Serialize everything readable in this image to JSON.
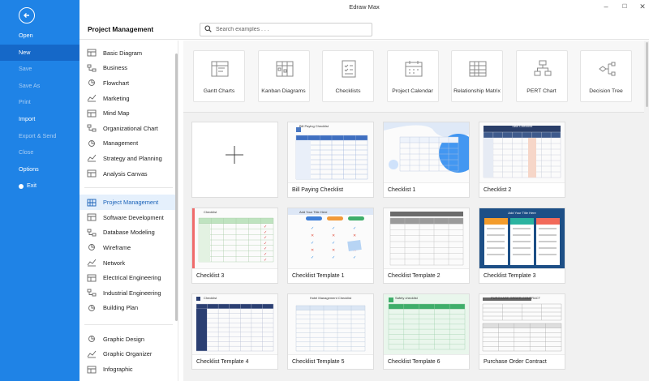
{
  "window": {
    "title": "Edraw Max",
    "controls": [
      "–",
      "☐",
      "✕"
    ]
  },
  "sidebar": {
    "items": [
      {
        "label": "Open",
        "state": "normal"
      },
      {
        "label": "New",
        "state": "active"
      },
      {
        "label": "Save",
        "state": "dim"
      },
      {
        "label": "Save As",
        "state": "dim"
      },
      {
        "label": "Print",
        "state": "dim"
      },
      {
        "label": "Import",
        "state": "normal"
      },
      {
        "label": "Export & Send",
        "state": "dim"
      },
      {
        "label": "Close",
        "state": "dim"
      },
      {
        "label": "Options",
        "state": "normal"
      },
      {
        "label": "Exit",
        "state": "normal"
      }
    ]
  },
  "header": {
    "section_title": "Project Management",
    "search_placeholder": "Search examples . . ."
  },
  "categories": {
    "group1": [
      {
        "label": "Basic Diagram",
        "icon": "basic-diagram-icon"
      },
      {
        "label": "Business",
        "icon": "business-icon"
      },
      {
        "label": "Flowchart",
        "icon": "flowchart-icon"
      },
      {
        "label": "Marketing",
        "icon": "marketing-icon"
      },
      {
        "label": "Mind Map",
        "icon": "mind-map-icon"
      },
      {
        "label": "Organizational Chart",
        "icon": "org-chart-icon"
      },
      {
        "label": "Management",
        "icon": "management-icon"
      },
      {
        "label": "Strategy and Planning",
        "icon": "strategy-icon"
      },
      {
        "label": "Analysis Canvas",
        "icon": "analysis-canvas-icon"
      }
    ],
    "group2": [
      {
        "label": "Project Management",
        "icon": "project-management-icon",
        "active": true
      },
      {
        "label": "Software Development",
        "icon": "software-icon"
      },
      {
        "label": "Database Modeling",
        "icon": "database-icon"
      },
      {
        "label": "Wireframe",
        "icon": "wireframe-icon"
      },
      {
        "label": "Network",
        "icon": "network-icon"
      },
      {
        "label": "Electrical Engineering",
        "icon": "electrical-icon"
      },
      {
        "label": "Industrial Engineering",
        "icon": "industrial-icon"
      },
      {
        "label": "Building Plan",
        "icon": "building-plan-icon"
      }
    ],
    "group3": [
      {
        "label": "Graphic Design",
        "icon": "graphic-design-icon"
      },
      {
        "label": "Graphic Organizer",
        "icon": "graphic-organizer-icon"
      },
      {
        "label": "Infographic",
        "icon": "infographic-icon"
      }
    ]
  },
  "quick_types": [
    {
      "label": "Gantt Charts",
      "icon": "gantt-icon"
    },
    {
      "label": "Kanban Diagrams",
      "icon": "kanban-icon"
    },
    {
      "label": "Checklists",
      "icon": "checklist-icon"
    },
    {
      "label": "Project Calendar",
      "icon": "calendar-icon"
    },
    {
      "label": "Relationship Matrix",
      "icon": "matrix-icon"
    },
    {
      "label": "PERT Chart",
      "icon": "pert-icon"
    },
    {
      "label": "Decision Tree",
      "icon": "decision-tree-icon"
    }
  ],
  "templates": [
    {
      "label": "",
      "kind": "blank"
    },
    {
      "label": "Bill Paying Checklist",
      "kind": "table-blue",
      "title": "Bill Paying Checklist"
    },
    {
      "label": "Checklist 1",
      "kind": "wave"
    },
    {
      "label": "Checklist 2",
      "kind": "dark-table",
      "title": "Task Checklist"
    },
    {
      "label": "Checklist 3",
      "kind": "green-table",
      "title": "Checklist"
    },
    {
      "label": "Checklist Template 1",
      "kind": "pills",
      "title": "Add Your Title Here"
    },
    {
      "label": "Checklist Template 2",
      "kind": "gray-table"
    },
    {
      "label": "Checklist Template 3",
      "kind": "columns",
      "title": "Add Your Title Here"
    },
    {
      "label": "Checklist Template 4",
      "kind": "navy-table",
      "title": "Checklist"
    },
    {
      "label": "Checklist Template 5",
      "kind": "hotel",
      "title": "Hotel Management Checklist"
    },
    {
      "label": "Checklist Template 6",
      "kind": "safety",
      "title": "Safety checklist"
    },
    {
      "label": "Purchase Order Contract",
      "kind": "contract",
      "title": "PURCHASE ORDER CONTRACT"
    }
  ],
  "colors": {
    "sidebar": "#1f83e6",
    "sidebar_active": "#1568c8",
    "category_active_bg": "#e5f0fc",
    "category_active_text": "#1a62b8"
  }
}
